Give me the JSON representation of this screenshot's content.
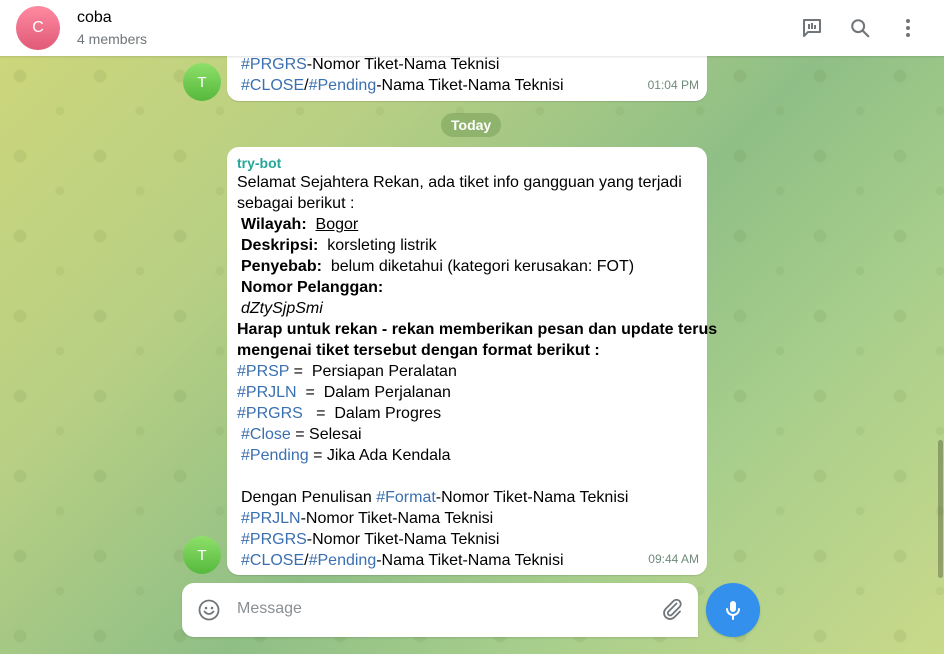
{
  "header": {
    "avatar_letter": "C",
    "title": "coba",
    "subtitle": "4 members",
    "icons": [
      "poll-icon",
      "search-icon",
      "more-vertical-icon"
    ]
  },
  "messages": [
    {
      "avatar_letter": "T",
      "lines": [
        {
          "tag": "#PRGRS",
          "text": "-Nomor Tiket-Nama Teknisi"
        },
        {
          "tag": "#CLOSE",
          "sep": "/",
          "tag2": "#Pending",
          "text": "-Nama Tiket-Nama Teknisi"
        }
      ],
      "time": "01:04 PM"
    },
    {
      "avatar_letter": "T",
      "sender": "try-bot",
      "intro_1": "Selamat Sejahtera Rekan, ada tiket info gangguan yang terjadi",
      "intro_2": "sebagai berikut :",
      "wilayah_label": "Wilayah:",
      "wilayah_value": "Bogor",
      "deskripsi_label": "Deskripsi:",
      "deskripsi_value": "korsleting listrik",
      "penyebab_label": "Penyebab:",
      "penyebab_value": "belum diketahui (kategori kerusakan: FOT)",
      "nomor_label": "Nomor Pelanggan:",
      "nomor_value": "dZtySjpSmi",
      "harap_1": "Harap untuk rekan - rekan memberikan pesan dan update terus",
      "harap_2": "mengenai tiket tersebut dengan format berikut :",
      "codes": [
        {
          "tag": "#PRSP",
          "text": " =  Persiapan Peralatan"
        },
        {
          "tag": "#PRJLN",
          "text": "  =  Dalam Perjalanan"
        },
        {
          "tag": "#PRGRS",
          "text": "   =  Dalam Progres"
        },
        {
          "tag": "#Close",
          "text": " = Selesai"
        },
        {
          "tag": "#Pending",
          "text": " = Jika Ada Kendala"
        }
      ],
      "penulisan_prefix": "Dengan Penulisan ",
      "penulisan_tag": "#Format",
      "penulisan_text": "-Nomor Tiket-Nama Teknisi",
      "format_lines": [
        {
          "tag": "#PRJLN",
          "text": "-Nomor Tiket-Nama Teknisi"
        },
        {
          "tag": "#PRGRS",
          "text": "-Nomor Tiket-Nama Teknisi"
        },
        {
          "tag": "#CLOSE",
          "sep": "/",
          "tag2": "#Pending",
          "text": "-Nama Tiket-Nama Teknisi"
        }
      ],
      "time": "09:44 AM"
    }
  ],
  "date_separator": "Today",
  "composer": {
    "placeholder": "Message",
    "icons": [
      "emoji-icon",
      "paperclip-icon",
      "microphone-icon"
    ]
  },
  "colors": {
    "accent": "#3390ec",
    "hashtag": "#3a6fb0",
    "sender": "#26a69a"
  }
}
